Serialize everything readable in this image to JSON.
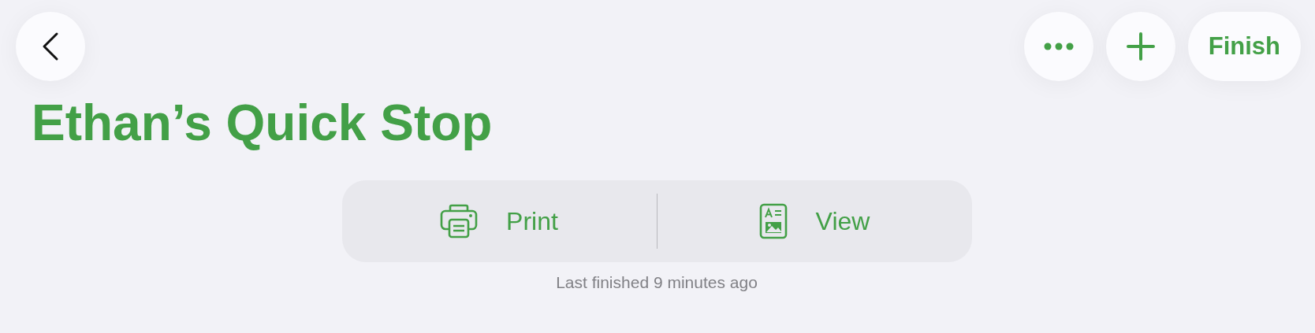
{
  "toolbar": {
    "finish_button": "Finish"
  },
  "title": "Ethan’s Quick Stop",
  "actions": [
    {
      "kind": "print",
      "label": "Print"
    },
    {
      "kind": "view",
      "label": "View"
    }
  ],
  "caption": "Last finished 9 minutes ago"
}
